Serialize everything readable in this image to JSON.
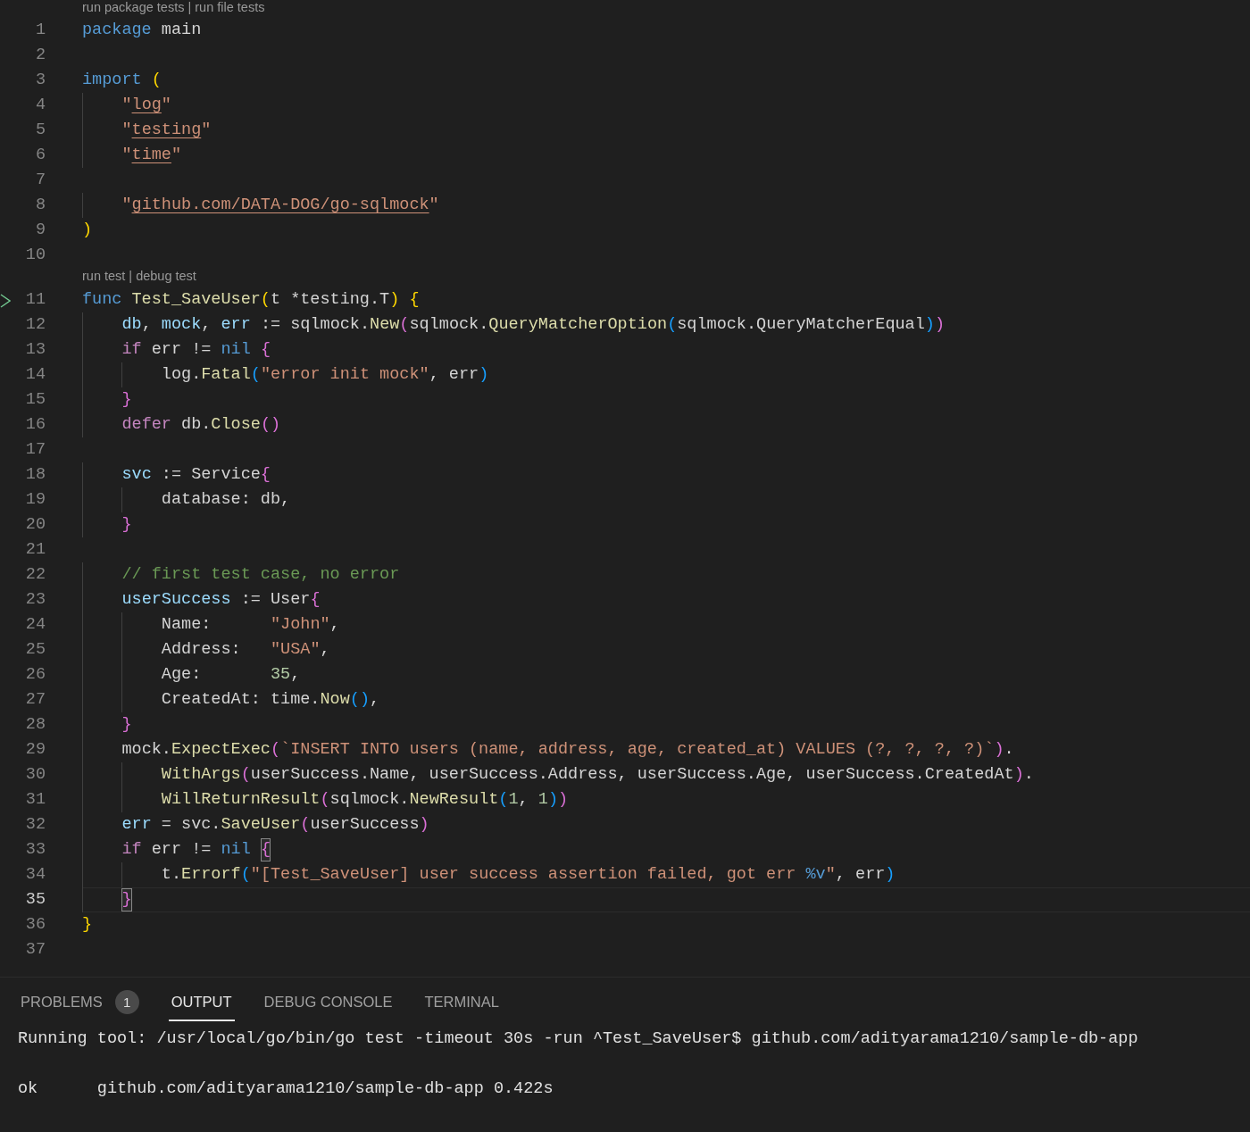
{
  "editor": {
    "lines": [
      {
        "number": "1",
        "run_marker": false,
        "current": false,
        "codelens": {
          "links": [
            "run package tests",
            "run file tests"
          ],
          "separator": "|"
        },
        "tokens": [
          {
            "keyword": "package"
          },
          {
            "plain": " main"
          }
        ]
      },
      {
        "number": "2",
        "run_marker": false,
        "current": false
      },
      {
        "number": "3",
        "run_marker": false,
        "current": false,
        "tokens": [
          {
            "keyword": "import "
          },
          {
            "bracket1": "("
          }
        ]
      },
      {
        "number": "4",
        "run_marker": false,
        "current": false,
        "tokens": [
          {
            "string": "    \""
          },
          {
            "link": "log"
          },
          {
            "string": "\""
          }
        ]
      },
      {
        "number": "5",
        "run_marker": false,
        "current": false,
        "tokens": [
          {
            "string": "    \""
          },
          {
            "link": "testing"
          },
          {
            "string": "\""
          }
        ]
      },
      {
        "number": "6",
        "run_marker": false,
        "current": false,
        "tokens": [
          {
            "string": "    \""
          },
          {
            "link": "time"
          },
          {
            "string": "\""
          }
        ]
      },
      {
        "number": "7",
        "run_marker": false,
        "current": false
      },
      {
        "number": "8",
        "run_marker": false,
        "current": false,
        "tokens": [
          {
            "string": "    \""
          },
          {
            "link": "github.com/DATA-DOG/go-sqlmock"
          },
          {
            "string": "\""
          }
        ]
      },
      {
        "number": "9",
        "run_marker": false,
        "current": false,
        "tokens": [
          {
            "bracket1": ")"
          }
        ]
      },
      {
        "number": "10",
        "run_marker": false,
        "current": false
      },
      {
        "number": "11",
        "run_marker": true,
        "current": false,
        "codelens": {
          "links": [
            "run test",
            "debug test"
          ],
          "separator": "|"
        },
        "tokens": [
          {
            "keyword": "func "
          },
          {
            "function": "Test_SaveUser"
          },
          {
            "bracket1": "("
          },
          {
            "plain": "t *testing.T"
          },
          {
            "bracket1": ") {"
          }
        ]
      },
      {
        "number": "12",
        "run_marker": false,
        "current": false,
        "tokens": [
          {
            "variable": "    db"
          },
          {
            "plain": ", "
          },
          {
            "variable": "mock"
          },
          {
            "plain": ", "
          },
          {
            "variable": "err"
          },
          {
            "plain": " := sqlmock."
          },
          {
            "function": "New"
          },
          {
            "bracket2": "("
          },
          {
            "plain": "sqlmock."
          },
          {
            "function": "QueryMatcherOption"
          },
          {
            "bracket3": "("
          },
          {
            "plain": "sqlmock.QueryMatcherEqual"
          },
          {
            "bracket3": ")"
          },
          {
            "bracket2": ")"
          }
        ]
      },
      {
        "number": "13",
        "run_marker": false,
        "current": false,
        "tokens": [
          {
            "control": "    if"
          },
          {
            "plain": " err != "
          },
          {
            "keyword": "nil "
          },
          {
            "bracket2": "{"
          }
        ]
      },
      {
        "number": "14",
        "run_marker": false,
        "current": false,
        "tokens": [
          {
            "plain": "        log."
          },
          {
            "function": "Fatal"
          },
          {
            "bracket3": "("
          },
          {
            "string": "\"error init mock\""
          },
          {
            "plain": ", err"
          },
          {
            "bracket3": ")"
          }
        ]
      },
      {
        "number": "15",
        "run_marker": false,
        "current": false,
        "tokens": [
          {
            "bracket2": "    }"
          }
        ]
      },
      {
        "number": "16",
        "run_marker": false,
        "current": false,
        "tokens": [
          {
            "control": "    defer"
          },
          {
            "plain": " db."
          },
          {
            "function": "Close"
          },
          {
            "bracket2": "()"
          }
        ]
      },
      {
        "number": "17",
        "run_marker": false,
        "current": false
      },
      {
        "number": "18",
        "run_marker": false,
        "current": false,
        "tokens": [
          {
            "variable": "    svc"
          },
          {
            "plain": " := Service"
          },
          {
            "bracket2": "{"
          }
        ]
      },
      {
        "number": "19",
        "run_marker": false,
        "current": false,
        "tokens": [
          {
            "plain": "        database: db,"
          }
        ]
      },
      {
        "number": "20",
        "run_marker": false,
        "current": false,
        "tokens": [
          {
            "bracket2": "    }"
          }
        ]
      },
      {
        "number": "21",
        "run_marker": false,
        "current": false
      },
      {
        "number": "22",
        "run_marker": false,
        "current": false,
        "tokens": [
          {
            "comment": "    // first test case, no error"
          }
        ]
      },
      {
        "number": "23",
        "run_marker": false,
        "current": false,
        "tokens": [
          {
            "variable": "    userSuccess"
          },
          {
            "plain": " := User"
          },
          {
            "bracket2": "{"
          }
        ]
      },
      {
        "number": "24",
        "run_marker": false,
        "current": false,
        "tokens": [
          {
            "plain": "        Name:      "
          },
          {
            "string": "\"John\""
          },
          {
            "plain": ","
          }
        ]
      },
      {
        "number": "25",
        "run_marker": false,
        "current": false,
        "tokens": [
          {
            "plain": "        Address:   "
          },
          {
            "string": "\"USA\""
          },
          {
            "plain": ","
          }
        ]
      },
      {
        "number": "26",
        "run_marker": false,
        "current": false,
        "tokens": [
          {
            "plain": "        Age:       "
          },
          {
            "number": "35"
          },
          {
            "plain": ","
          }
        ]
      },
      {
        "number": "27",
        "run_marker": false,
        "current": false,
        "tokens": [
          {
            "plain": "        CreatedAt: time."
          },
          {
            "function": "Now"
          },
          {
            "bracket3": "()"
          },
          {
            "plain": ","
          }
        ]
      },
      {
        "number": "28",
        "run_marker": false,
        "current": false,
        "tokens": [
          {
            "bracket2": "    }"
          }
        ]
      },
      {
        "number": "29",
        "run_marker": false,
        "current": false,
        "tokens": [
          {
            "plain": "    mock."
          },
          {
            "function": "ExpectExec"
          },
          {
            "bracket2": "("
          },
          {
            "string": "`INSERT INTO users (name, address, age, created_at) VALUES (?, ?, ?, ?)`"
          },
          {
            "bracket2": ")"
          },
          {
            "plain": "."
          }
        ]
      },
      {
        "number": "30",
        "run_marker": false,
        "current": false,
        "tokens": [
          {
            "function": "        WithArgs"
          },
          {
            "bracket2": "("
          },
          {
            "plain": "userSuccess.Name, userSuccess.Address, userSuccess.Age, userSuccess.CreatedAt"
          },
          {
            "bracket2": ")"
          },
          {
            "plain": "."
          }
        ]
      },
      {
        "number": "31",
        "run_marker": false,
        "current": false,
        "tokens": [
          {
            "function": "        WillReturnResult"
          },
          {
            "bracket2": "("
          },
          {
            "plain": "sqlmock."
          },
          {
            "function": "NewResult"
          },
          {
            "bracket3": "("
          },
          {
            "number": "1"
          },
          {
            "plain": ", "
          },
          {
            "number": "1"
          },
          {
            "bracket3": ")"
          },
          {
            "bracket2": ")"
          }
        ]
      },
      {
        "number": "32",
        "run_marker": false,
        "current": false,
        "tokens": [
          {
            "variable": "    err"
          },
          {
            "plain": " = svc."
          },
          {
            "function": "SaveUser"
          },
          {
            "bracket2": "("
          },
          {
            "plain": "userSuccess"
          },
          {
            "bracket2": ")"
          }
        ]
      },
      {
        "number": "33",
        "run_marker": false,
        "current": false,
        "tokens": [
          {
            "control": "    if"
          },
          {
            "plain": " err != "
          },
          {
            "keyword": "nil "
          },
          {
            "bracket2": "{",
            "matched": true
          }
        ]
      },
      {
        "number": "34",
        "run_marker": false,
        "current": false,
        "tokens": [
          {
            "plain": "        t."
          },
          {
            "function": "Errorf"
          },
          {
            "bracket3": "("
          },
          {
            "string": "\"[Test_SaveUser] user success assertion failed, got err "
          },
          {
            "format": "%v"
          },
          {
            "string": "\""
          },
          {
            "plain": ", err"
          },
          {
            "bracket3": ")"
          }
        ]
      },
      {
        "number": "35",
        "run_marker": false,
        "current": true,
        "tokens": [
          {
            "bracket2": "    }",
            "matched": true
          }
        ]
      },
      {
        "number": "36",
        "run_marker": false,
        "current": false,
        "tokens": [
          {
            "bracket1": "}"
          }
        ]
      },
      {
        "number": "37",
        "run_marker": false,
        "current": false
      }
    ]
  },
  "panel": {
    "tabs": [
      {
        "label": "PROBLEMS",
        "selected": false,
        "badge": "1"
      },
      {
        "label": "OUTPUT",
        "selected": true
      },
      {
        "label": "DEBUG CONSOLE",
        "selected": false
      },
      {
        "label": "TERMINAL",
        "selected": false
      }
    ],
    "output": [
      {
        "kind": "command",
        "text": "Running tool: /usr/local/go/bin/go test -timeout 30s -run ^Test_SaveUser$ github.com/adityarama1210/sample-db-app"
      },
      {
        "kind": "result",
        "text": "ok      github.com/adityarama1210/sample-db-app 0.422s"
      }
    ]
  }
}
